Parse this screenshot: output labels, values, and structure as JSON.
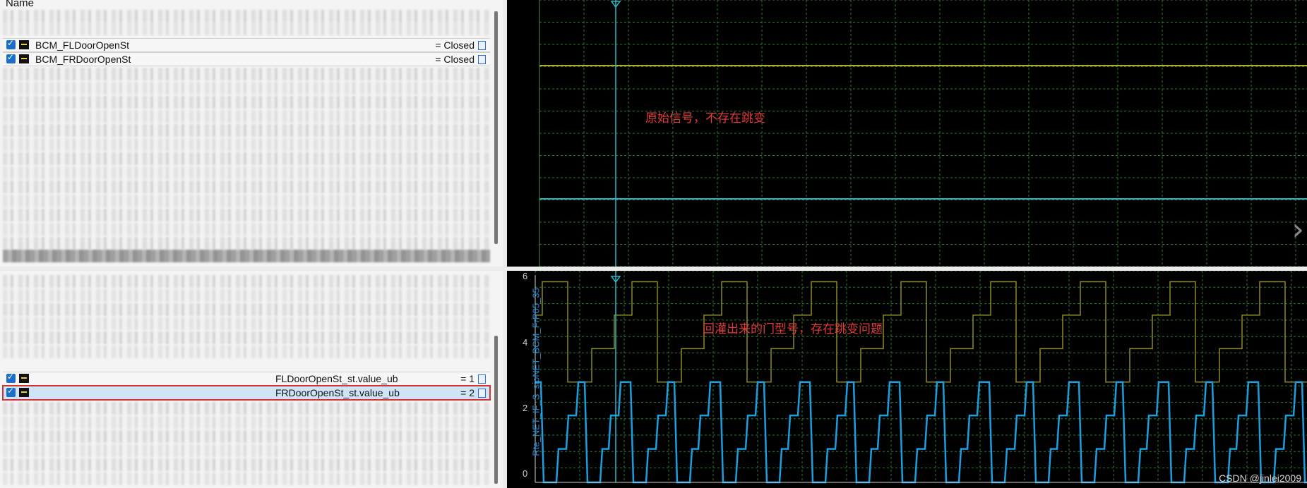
{
  "top_panel": {
    "header_name": "Name",
    "signals": [
      {
        "name": "BCM_FLDoorOpenSt",
        "value": "= Closed"
      },
      {
        "name": "BCM_FRDoorOpenSt",
        "value": "= Closed"
      }
    ],
    "annotation": "原始信号，不存在跳变"
  },
  "bottom_panel": {
    "signals": [
      {
        "name": "FLDoorOpenSt_st.value_ub",
        "value": "= 1"
      },
      {
        "name": "FRDoorOpenSt_st.value_ub",
        "value": "= 2"
      }
    ],
    "annotation": "回灌出来的门型号，存在跳变问题",
    "y_axis_label": "Rte_NET_IF_S_sioNET_BCM_FrP05_35",
    "y_ticks": [
      "6",
      "4",
      "2",
      "0"
    ]
  },
  "colors": {
    "grid": "#2f7a2f",
    "cursor": "#2fb8c8",
    "trace_yellow": "#b6ad22",
    "trace_cyan": "#2ab0c8",
    "trace_olive": "#8a8a20",
    "trace_blue": "#1a9ee0",
    "annotation": "#e23a3a"
  },
  "watermark": "CSDN @jinlei2009"
}
